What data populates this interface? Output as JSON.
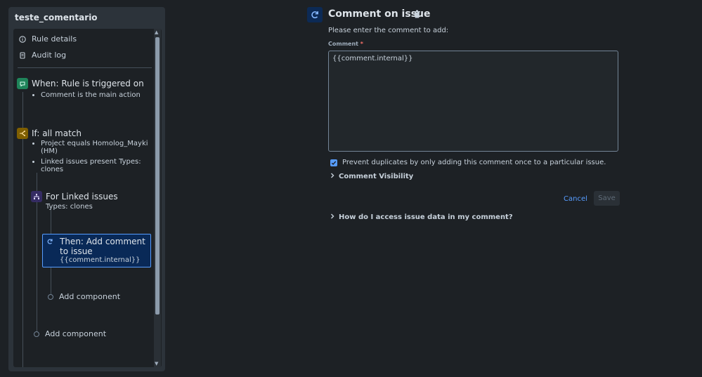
{
  "rule": {
    "name": "teste_comentario",
    "nav": [
      {
        "label": "Rule details",
        "icon": "info-icon"
      },
      {
        "label": "Audit log",
        "icon": "document-icon"
      }
    ],
    "trigger": {
      "title": "When: Rule is triggered on",
      "bullets": [
        "Comment is the main action"
      ],
      "icon": "comment-trigger-icon",
      "color": "#1f845a"
    },
    "condition": {
      "title": "If: all match",
      "bullets": [
        "Project equals Homolog_Mayki (HM)",
        "Linked issues present Types: clones"
      ],
      "icon": "branch-icon",
      "color": "#7f5f01"
    },
    "branch": {
      "title": "For Linked issues",
      "subtitle": "Types: clones",
      "icon": "hierarchy-icon",
      "color": "#352c63"
    },
    "action": {
      "title": "Then: Add comment to issue",
      "subtitle": "{{comment.internal}}",
      "icon": "refresh-icon"
    },
    "add_component_inner": "Add component",
    "add_component_outer": "Add component"
  },
  "editor": {
    "title": "Comment on issue",
    "prompt": "Please enter the comment to add:",
    "comment_label": "Comment",
    "required_mark": "*",
    "comment_value": "{{comment.internal}}",
    "prevent_duplicates": {
      "checked": true,
      "label": "Prevent duplicates by only adding this comment once to a particular issue."
    },
    "visibility_label": "Comment Visibility",
    "cancel_label": "Cancel",
    "save_label": "Save",
    "help_label": "How do I access issue data in my comment?"
  },
  "colors": {
    "accent": "#579dff",
    "background": "#1d2125"
  }
}
